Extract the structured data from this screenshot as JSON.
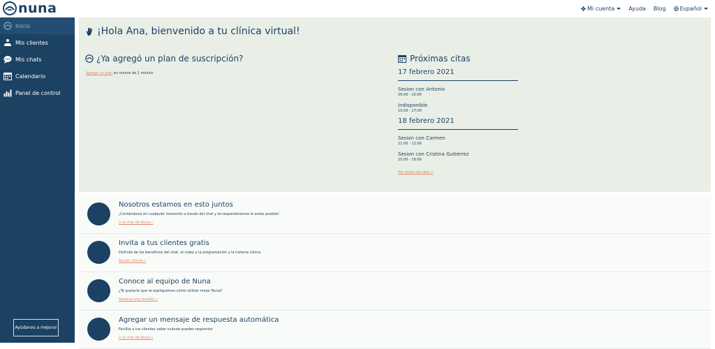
{
  "brand": {
    "name": "nuna"
  },
  "topnav": {
    "account": "Mi cuenta",
    "help": "Ayuda",
    "blog": "Blog",
    "language": "Español"
  },
  "sidebar": {
    "items": [
      {
        "label": "Inicio",
        "icon": "home-icon"
      },
      {
        "label": "Mis clientes",
        "icon": "clients-icon"
      },
      {
        "label": "Mis chats",
        "icon": "chat-icon"
      },
      {
        "label": "Calendario",
        "icon": "calendar-icon"
      },
      {
        "label": "Panel de control",
        "icon": "dashboard-icon"
      }
    ],
    "help_button": "Ayúdanos a mejorar"
  },
  "hero": {
    "title": "¡Hola Ana, bienvenido a tu clínica virtual!",
    "subscription_title": "¿Ya agregó un plan de suscripción?",
    "subscription_link": "Agrega un plan",
    "subscription_rest": " en menos de 1 minuto"
  },
  "appointments": {
    "title": "Próximas citas",
    "days": [
      {
        "date": "17 febrero 2021",
        "sessions": [
          {
            "name": "Sesion con Antonio",
            "time": "09:00 - 10:00"
          },
          {
            "name": "Indisponible",
            "time": "10:00 - 17:00"
          }
        ]
      },
      {
        "date": "18 febrero 2021",
        "sessions": [
          {
            "name": "Sesion con Carmen",
            "time": "11:00 - 12:00"
          },
          {
            "name": "Sesion con Cristina Gutiérrez",
            "time": "15:00 - 16:00"
          }
        ]
      }
    ],
    "see_all": "Ver todas las citas »"
  },
  "cards": [
    {
      "title": "Nosotros estamos en esto juntos",
      "desc": "¡Contáctanos en cualquier momento a través del chat y te responderemos lo antes posible!",
      "link": "Ir al chat de Nuna »"
    },
    {
      "title": "Invita a tus clientes gratis",
      "desc": "Disfrute de los beneficios del chat, el video y la programación y la historia clínica",
      "link": "Añadir cliente »"
    },
    {
      "title": "Conoce al equipo de Nuna",
      "desc": "¿Te gustaría que te expliquemos cómo utilizar mejor Nuna?",
      "link": "Reserva una reunión »"
    },
    {
      "title": "Agregar un mensaje de respuesta automática",
      "desc": "Facilita a tus clientes saber cuándo puedes responder",
      "link": "Ir al chat de Nuna »"
    }
  ],
  "colors": {
    "primary": "#1b4163",
    "accent": "#e1866b",
    "hero_bg": "#e9efe6"
  }
}
